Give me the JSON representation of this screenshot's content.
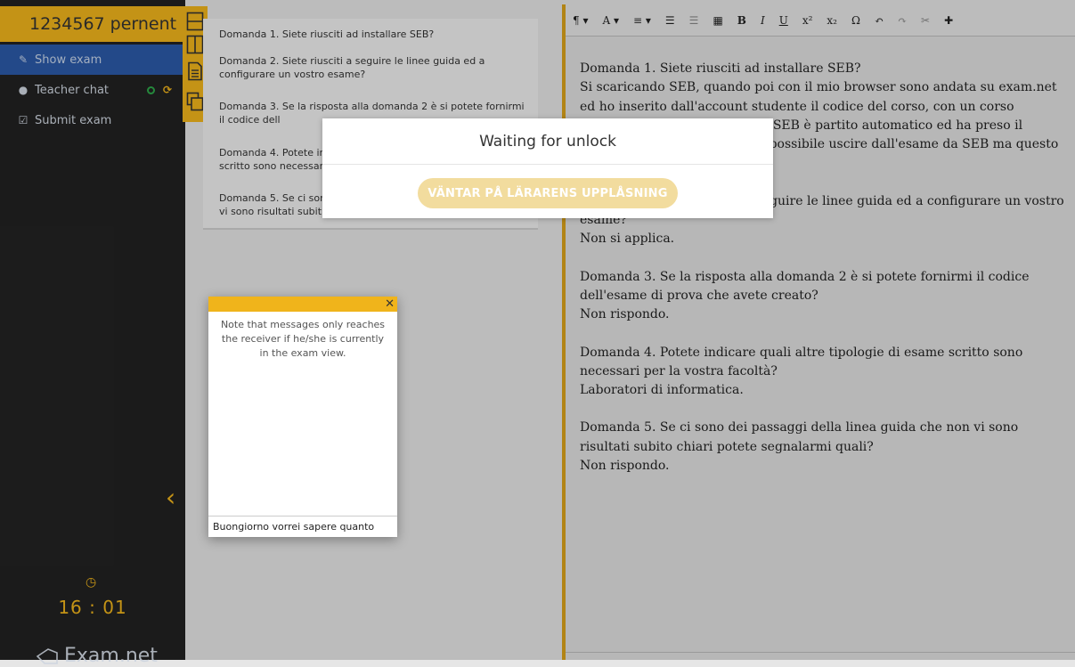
{
  "sidebar": {
    "header": "1234567 pernent",
    "items": [
      {
        "label": "Show exam",
        "icon": "edit-icon"
      },
      {
        "label": "Teacher chat",
        "icon": "chat-icon"
      },
      {
        "label": "Submit exam",
        "icon": "check-square-icon"
      }
    ],
    "timer": "16 : 01",
    "logo": "Exam.net"
  },
  "questions": [
    "Domanda 1. Siete riusciti ad installare SEB?",
    "Domanda 2. Siete riusciti a seguire le linee guida ed a configurare un vostro esame?",
    "Domanda 3. Se la risposta alla domanda 2 è si potete fornirmi il codice dell",
    "Domanda 4. Potete in scritto sono necessar",
    "Domanda 5. Se ci sor vi sono risultati subit"
  ],
  "editor": {
    "paragraphs": [
      "Domanda 1. Siete riusciti ad installare SEB?\nSi scaricando SEB, quando poi con il mio browser sono andata su exam.net ed ho inserito dall'account studente il codice del corso, con un corso configurato per alta sicurezza SEB è partito automatico ed ha preso il controllo dello schermo. E' impossibile uscire dall'esame da SEB ma questo comportamento viene",
      "Domanda 2. Siete riusciti a seguire le linee guida ed a configurare un vostro esame?\nNon si applica.",
      "Domanda 3. Se la risposta alla domanda 2 è si potete fornirmi il codice dell'esame di prova che avete creato?\nNon rispondo.",
      "Domanda 4. Potete indicare quali altre tipologie di esame scritto sono necessari per la vostra facoltà?\nLaboratori di informatica.",
      "Domanda 5. Se ci sono dei passaggi della linea guida che non vi sono risultati subito chiari potete segnalarmi quali?\nNon rispondo."
    ]
  },
  "modal": {
    "title": "Waiting for unlock",
    "button": "VÄNTAR PÅ LÄRARENS UPPLÅSNING"
  },
  "chat": {
    "note": "Note that messages only reaches the receiver if he/she is currently in the exam view.",
    "input_value": "Buongiorno vorrei sapere quanto"
  },
  "colors": {
    "accent": "#f0b41b",
    "sidebar": "#222222",
    "active": "#2b5aa8"
  }
}
